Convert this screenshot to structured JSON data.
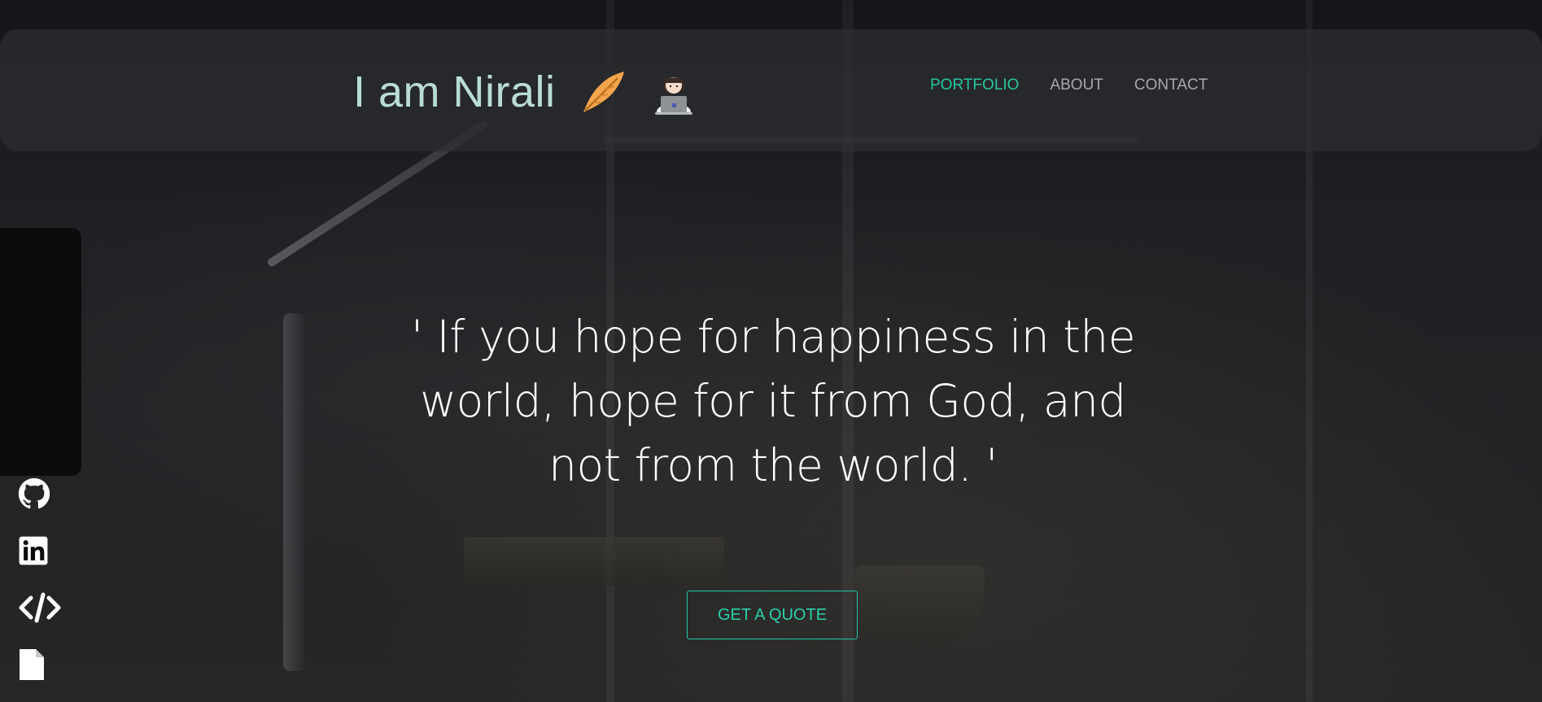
{
  "header": {
    "brand_text": "I am Nirali",
    "brand_icons": [
      "feather-icon",
      "woman-technologist-icon"
    ],
    "nav": [
      {
        "label": "PORTFOLIO",
        "active": true
      },
      {
        "label": "ABOUT",
        "active": false
      },
      {
        "label": "CONTACT",
        "active": false
      }
    ]
  },
  "sidebar": {
    "links": [
      {
        "icon": "github-icon"
      },
      {
        "icon": "linkedin-icon"
      },
      {
        "icon": "code-icon"
      },
      {
        "icon": "document-icon"
      }
    ]
  },
  "hero": {
    "quote": "' If you hope for happiness in the world, hope for it from God, and not from the world. '",
    "cta_label": "GET A QUOTE"
  },
  "colors": {
    "accent": "#27c7a0",
    "brand_text": "#b9dcd4",
    "nav_text": "#a7a9ad",
    "sidebar_bg": "#0c0c0d"
  }
}
